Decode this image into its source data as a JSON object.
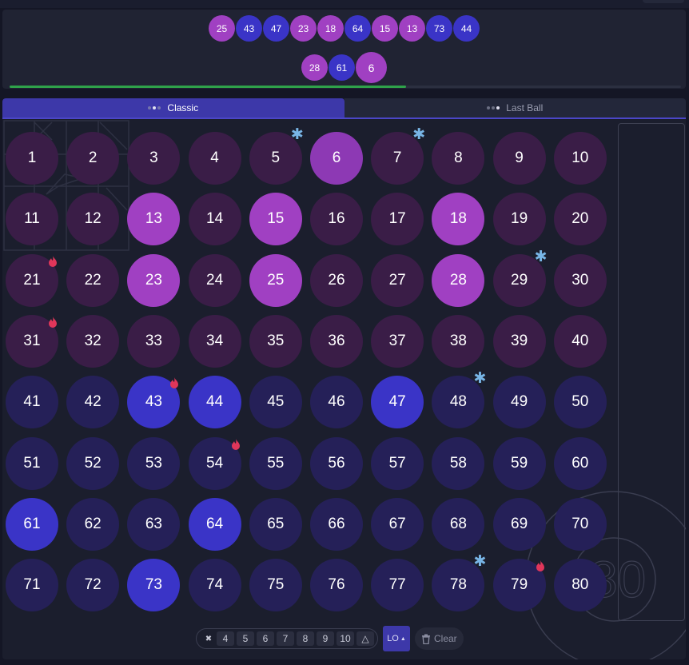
{
  "drawn_balls": {
    "row1": [
      {
        "n": "25",
        "color": "#a040c2"
      },
      {
        "n": "43",
        "color": "#3a34c7"
      },
      {
        "n": "47",
        "color": "#3a34c7"
      },
      {
        "n": "23",
        "color": "#a040c2"
      },
      {
        "n": "18",
        "color": "#a040c2"
      },
      {
        "n": "64",
        "color": "#3a34c7"
      },
      {
        "n": "15",
        "color": "#a040c2"
      },
      {
        "n": "13",
        "color": "#a040c2"
      },
      {
        "n": "73",
        "color": "#3a34c7"
      },
      {
        "n": "44",
        "color": "#3a34c7"
      }
    ],
    "row2": [
      {
        "n": "28",
        "color": "#a040c2"
      },
      {
        "n": "61",
        "color": "#3a34c7"
      },
      {
        "n": "6",
        "color": "#a040c2",
        "latest": true
      }
    ],
    "progress_percent": 59
  },
  "tabs": [
    {
      "label": "Classic",
      "active": true
    },
    {
      "label": "Last Ball",
      "active": false
    }
  ],
  "board": {
    "numbers_hit": [
      6,
      13,
      15,
      18,
      23,
      25,
      28,
      43,
      44,
      47,
      61,
      64,
      73
    ],
    "cold_numbers": [
      5,
      7,
      29,
      48,
      78
    ],
    "hot_numbers": [
      21,
      31,
      43,
      54,
      79
    ],
    "colors": {
      "top_idle": "#3a1d47",
      "top_hit": "#a040c2",
      "top_hit_latest": "#8d39b4",
      "bottom_idle": "#252058",
      "bottom_hit": "#3a34c7",
      "cold_icon": "#78b5e6",
      "hot_icon": "#e0365a"
    }
  },
  "controls": {
    "pick_counts": [
      "4",
      "5",
      "6",
      "7",
      "8",
      "9",
      "10"
    ],
    "shuffle_icon": "shuffle-icon",
    "triangle_icon": "triangle-icon",
    "lo_label": "LO",
    "clear_label": "Clear",
    "trash_icon": "trash-icon"
  },
  "deco": {
    "watermark_text": "80"
  }
}
